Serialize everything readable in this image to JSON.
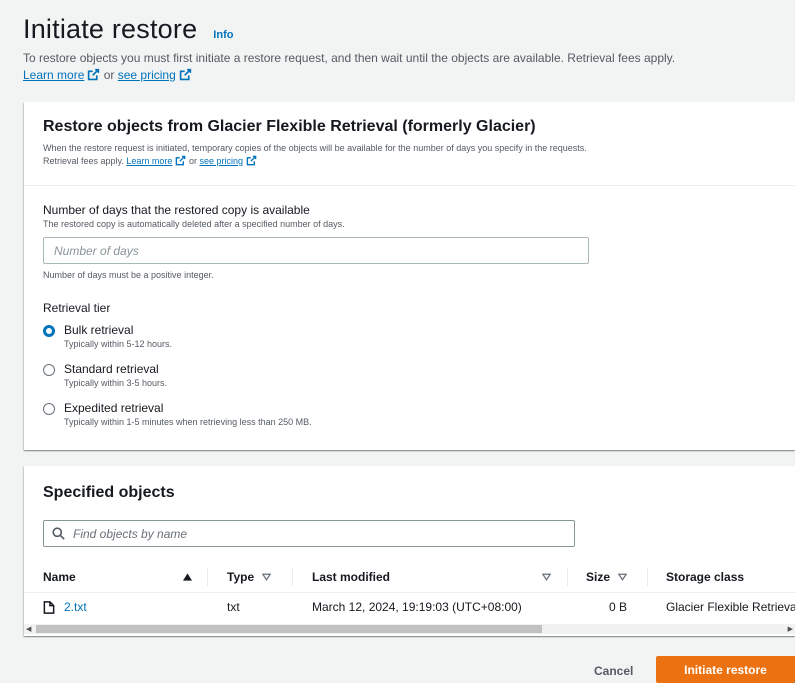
{
  "page": {
    "title": "Initiate restore",
    "info_label": "Info",
    "description": "To restore objects you must first initiate a restore request, and then wait until the objects are available. Retrieval fees apply.",
    "learn_more": "Learn more",
    "or": "or",
    "see_pricing": "see pricing"
  },
  "restore_panel": {
    "title": "Restore objects from Glacier Flexible Retrieval (formerly Glacier)",
    "description_line1": "When the restore request is initiated, temporary copies of the objects will be available for the number of days you specify in the requests.",
    "description_line2": "Retrieval fees apply.",
    "learn_more": "Learn more",
    "or": "or",
    "see_pricing": "see pricing",
    "days": {
      "label": "Number of days that the restored copy is available",
      "description": "The restored copy is automatically deleted after a specified number of days.",
      "value": "",
      "placeholder": "Number of days",
      "constraint": "Number of days must be a positive integer."
    },
    "tier": {
      "label": "Retrieval tier",
      "options": [
        {
          "title": "Bulk retrieval",
          "subtitle": "Typically within 5-12 hours.",
          "selected": true
        },
        {
          "title": "Standard retrieval",
          "subtitle": "Typically within 3-5 hours.",
          "selected": false
        },
        {
          "title": "Expedited retrieval",
          "subtitle": "Typically within 1-5 minutes when retrieving less than 250 MB.",
          "selected": false
        }
      ]
    }
  },
  "objects_panel": {
    "title": "Specified objects",
    "search_placeholder": "Find objects by name",
    "columns": [
      "Name",
      "Type",
      "Last modified",
      "Size",
      "Storage class"
    ],
    "rows": [
      {
        "name": "2.txt",
        "type": "txt",
        "last_modified": "March 12, 2024, 19:19:03 (UTC+08:00)",
        "size": "0 B",
        "storage_class": "Glacier Flexible Retrieval"
      }
    ]
  },
  "footer": {
    "cancel_label": "Cancel",
    "submit_label": "Initiate restore"
  },
  "colors": {
    "link": "#0073bb",
    "primary_button": "#ec7211",
    "selected_radio": "#0073bb"
  }
}
